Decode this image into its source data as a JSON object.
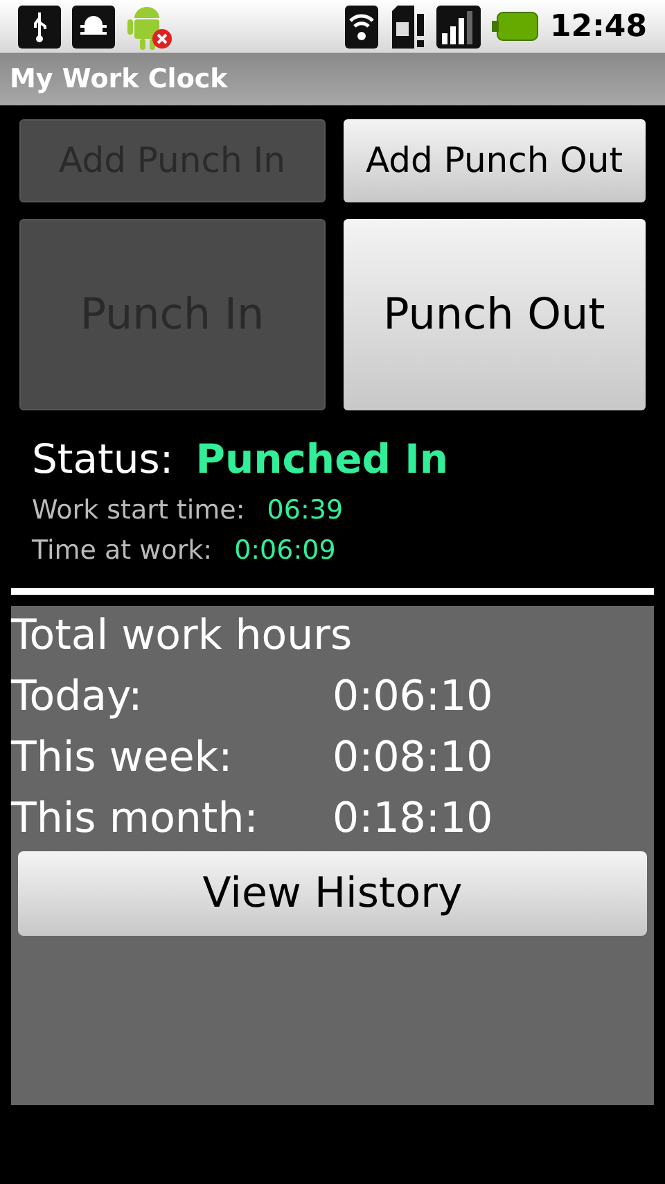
{
  "status_bar": {
    "time": "12:48"
  },
  "app_title": "My Work Clock",
  "small_buttons": [
    {
      "label": "Add Punch In",
      "disabled": true
    },
    {
      "label": "Add Punch Out",
      "disabled": false
    }
  ],
  "big_buttons": [
    {
      "label": "Punch In",
      "disabled": true
    },
    {
      "label": "Punch Out",
      "disabled": false
    }
  ],
  "status": {
    "label": "Status:",
    "value": "Punched In"
  },
  "details": [
    {
      "label": "Work start time:",
      "value": "06:39"
    },
    {
      "label": "Time at work:",
      "value": "0:06:09"
    }
  ],
  "totals": {
    "heading": "Total work hours",
    "rows": [
      {
        "label": "Today:",
        "value": "0:06:10"
      },
      {
        "label": "This week:",
        "value": "0:08:10"
      },
      {
        "label": "This month:",
        "value": "0:18:10"
      }
    ],
    "button": "View History"
  }
}
